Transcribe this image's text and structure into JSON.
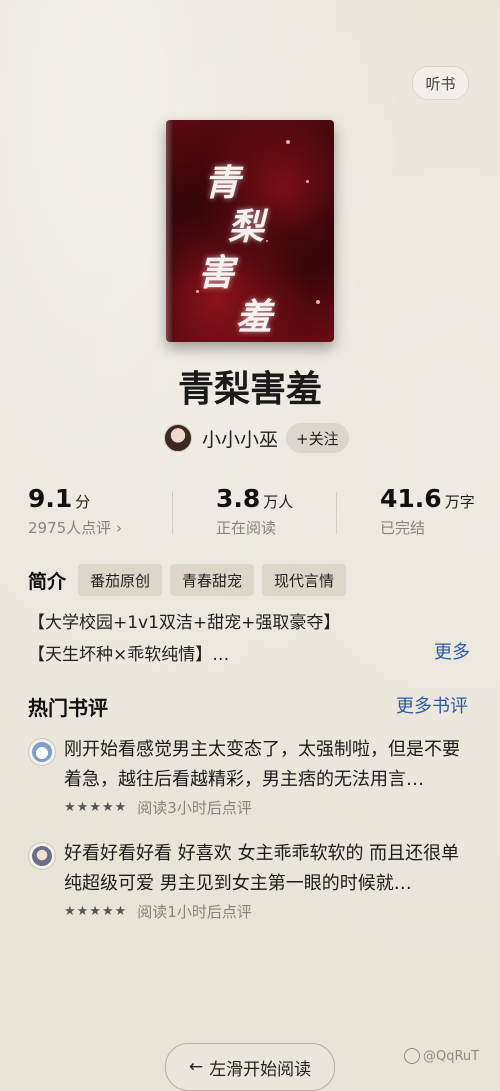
{
  "header": {
    "listen_label": "听书"
  },
  "book": {
    "cover_chars": [
      "青",
      "梨",
      "害",
      "羞"
    ],
    "title": "青梨害羞",
    "author": "小小小巫",
    "follow_label": "+关注"
  },
  "stats": [
    {
      "value": "9.1",
      "unit": "分",
      "sub": "2975人点评 ›"
    },
    {
      "value": "3.8",
      "unit": "万人",
      "sub": "正在阅读"
    },
    {
      "value": "41.6",
      "unit": "万字",
      "sub": "已完结"
    }
  ],
  "intro": {
    "label": "简介",
    "tags": [
      "番茄原创",
      "青春甜宠",
      "现代言情"
    ],
    "lines": [
      "【大学校园+1v1双洁+甜宠+强取豪夺】",
      "【天生坏种×乖软纯情】…"
    ],
    "more_label": "更多"
  },
  "reviews_section": {
    "title": "热门书评",
    "more_label": "更多书评",
    "items": [
      {
        "text": "刚开始看感觉男主太变态了，太强制啦，但是不要着急，越往后看越精彩，男主痞的无法用言…",
        "stars": "★★★★★",
        "meta": "阅读3小时后点评",
        "rating": 5
      },
      {
        "text": "好看好看好看 好喜欢 女主乖乖软软的 而且还很单纯超级可爱 男主见到女主第一眼的时候就…",
        "stars": "★★★★★",
        "meta": "阅读1小时后点评",
        "rating": 5
      }
    ]
  },
  "footer": {
    "start_label": "左滑开始阅读",
    "arrow": "←",
    "watermark": "@QqRuT"
  }
}
